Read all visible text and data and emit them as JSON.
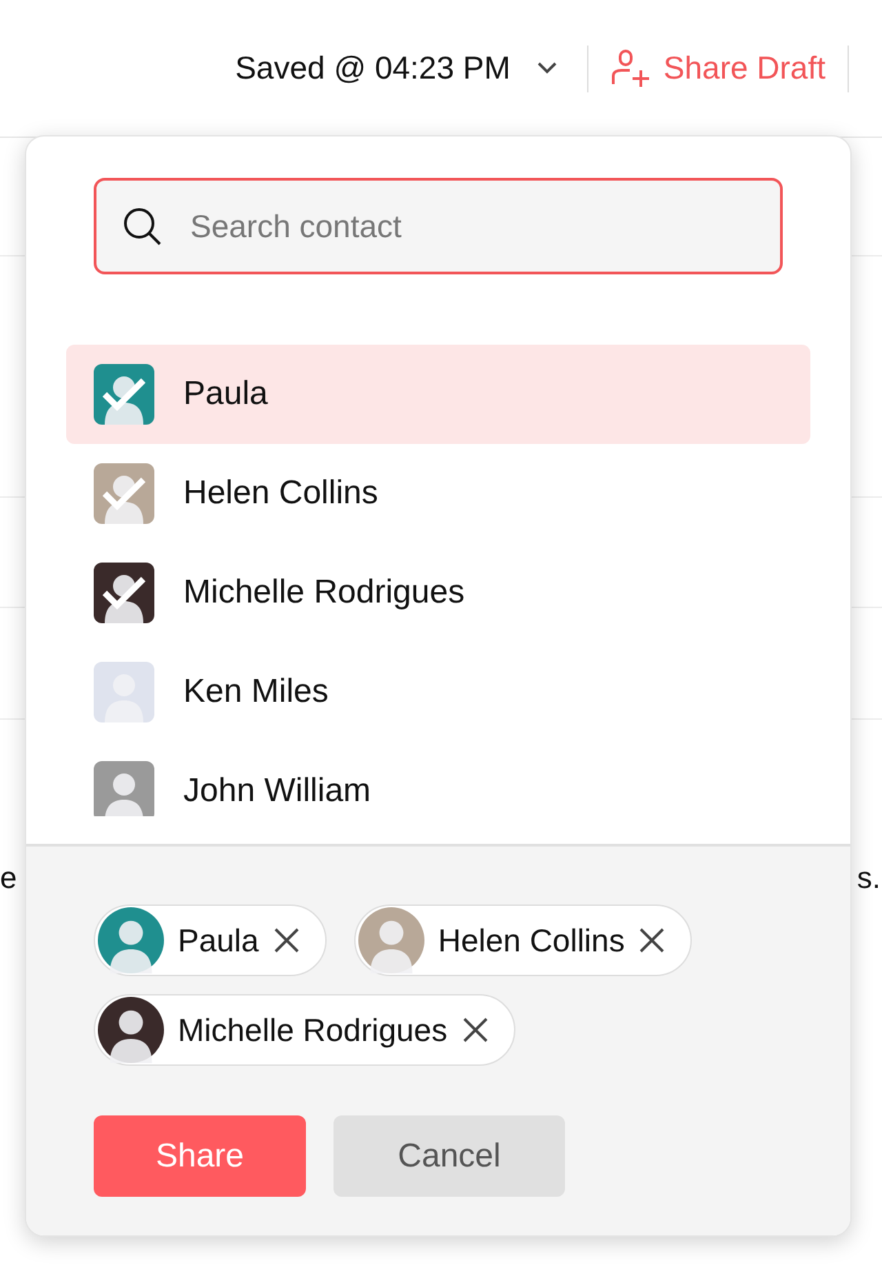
{
  "header": {
    "saved_status": "Saved @ 04:23 PM",
    "share_draft": "Share Draft"
  },
  "background_text": {
    "left": "e",
    "right": "s."
  },
  "popup": {
    "search": {
      "placeholder": "Search contact"
    },
    "contacts": [
      {
        "name": "Paula",
        "checked": true,
        "selected": true
      },
      {
        "name": "Helen Collins",
        "checked": true,
        "selected": false
      },
      {
        "name": "Michelle Rodrigues",
        "checked": true,
        "selected": false
      },
      {
        "name": "Ken Miles",
        "checked": false,
        "selected": false
      },
      {
        "name": "John William",
        "checked": false,
        "selected": false
      }
    ],
    "chips": [
      {
        "name": "Paula"
      },
      {
        "name": "Helen Collins"
      },
      {
        "name": "Michelle Rodrigues"
      }
    ],
    "buttons": [
      {
        "label": "Share",
        "kind": "primary"
      },
      {
        "label": "Cancel",
        "kind": "secondary"
      }
    ]
  }
}
